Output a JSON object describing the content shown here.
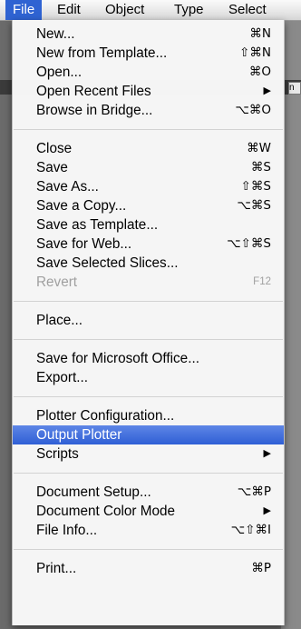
{
  "menubar": {
    "items": [
      {
        "label": "File",
        "active": true
      },
      {
        "label": "Edit"
      },
      {
        "label": "Object"
      },
      {
        "label": "Type"
      },
      {
        "label": "Select"
      }
    ]
  },
  "background": {
    "fragment": "n"
  },
  "file_menu": {
    "new": {
      "label": "New...",
      "shortcut": "⌘N"
    },
    "new_from_template": {
      "label": "New from Template...",
      "shortcut": "⇧⌘N"
    },
    "open": {
      "label": "Open...",
      "shortcut": "⌘O"
    },
    "open_recent": {
      "label": "Open Recent Files",
      "submenu": "▶"
    },
    "browse_bridge": {
      "label": "Browse in Bridge...",
      "shortcut": "⌥⌘O"
    },
    "close": {
      "label": "Close",
      "shortcut": "⌘W"
    },
    "save": {
      "label": "Save",
      "shortcut": "⌘S"
    },
    "save_as": {
      "label": "Save As...",
      "shortcut": "⇧⌘S"
    },
    "save_copy": {
      "label": "Save a Copy...",
      "shortcut": "⌥⌘S"
    },
    "save_template": {
      "label": "Save as Template..."
    },
    "save_web": {
      "label": "Save for Web...",
      "shortcut": "⌥⇧⌘S"
    },
    "save_slices": {
      "label": "Save Selected Slices..."
    },
    "revert": {
      "label": "Revert",
      "shortcut": "F12",
      "disabled": true
    },
    "place": {
      "label": "Place..."
    },
    "save_office": {
      "label": "Save for Microsoft Office..."
    },
    "export": {
      "label": "Export..."
    },
    "plotter_config": {
      "label": "Plotter Configuration..."
    },
    "output_plotter": {
      "label": "Output Plotter",
      "highlighted": true
    },
    "scripts": {
      "label": "Scripts",
      "submenu": "▶"
    },
    "doc_setup": {
      "label": "Document Setup...",
      "shortcut": "⌥⌘P"
    },
    "doc_color": {
      "label": "Document Color Mode",
      "submenu": "▶"
    },
    "file_info": {
      "label": "File Info...",
      "shortcut": "⌥⇧⌘I"
    },
    "print": {
      "label": "Print...",
      "shortcut": "⌘P"
    }
  }
}
